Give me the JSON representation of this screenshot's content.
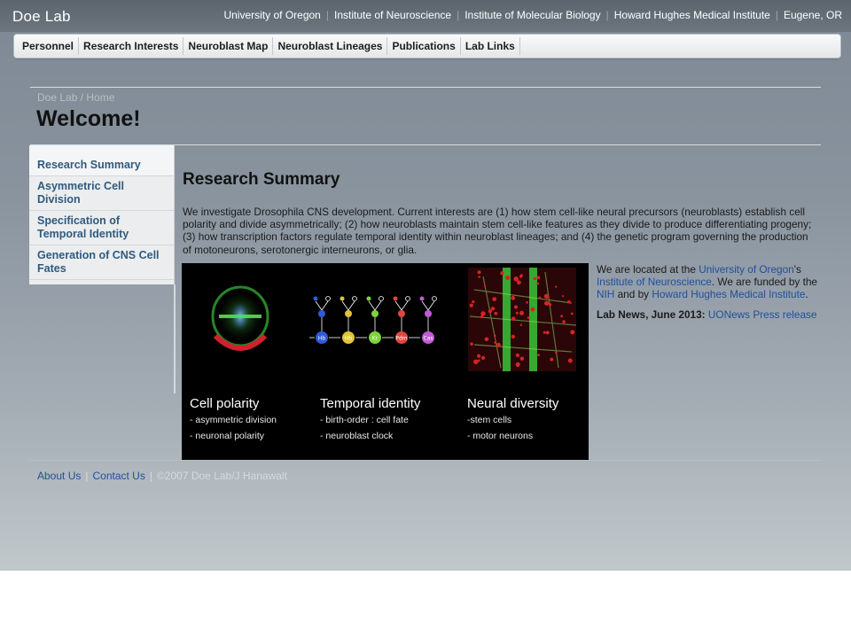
{
  "site": {
    "title": "Doe Lab"
  },
  "affiliations": [
    "University of Oregon",
    "Institute of Neuroscience",
    "Institute of Molecular Biology",
    "Howard Hughes Medical Institute",
    "Eugene, OR"
  ],
  "nav": [
    "Personnel",
    "Research Interests",
    "Neuroblast Map",
    "Neuroblast Lineages",
    "Publications",
    "Lab Links"
  ],
  "breadcrumb": {
    "root": "Doe Lab",
    "sep": " / ",
    "current": "Home"
  },
  "page_title": "Welcome!",
  "sidebar": [
    "Research Summary",
    "Asymmetric Cell Division",
    "Specification of Temporal Identity",
    "Generation of CNS Cell Fates"
  ],
  "main": {
    "title": "Research Summary",
    "summary": "We investigate Drosophila CNS development. Current interests are (1) how stem cell-like neural precursors (neuroblasts) establish cell polarity and divide asymmetrically; (2) how neuroblasts maintain stem cell-like features as they divide to produce differentiating progeny; (3) how transcription factors regulate temporal identity within neuroblast lineages; and (4) the genetic program governing the production of motoneurons, serotonergic interneurons, or glia."
  },
  "figure": {
    "panels": [
      {
        "heading": "Cell polarity",
        "lines": [
          "- asymmetric division",
          "- neuronal polarity"
        ]
      },
      {
        "heading": "Temporal identity",
        "lines": [
          "- birth-order : cell fate",
          "- neuroblast clock"
        ]
      },
      {
        "heading": "Neural diversity",
        "lines": [
          "-stem cells",
          "- motor neurons"
        ]
      }
    ],
    "factors": [
      "Hb",
      "Kr",
      "Pdm",
      "Cas"
    ],
    "factors_labels": [
      "Hb",
      "Hb",
      "Kr",
      "Pdm",
      "Cas"
    ]
  },
  "info": {
    "p1_a": "We are located at the ",
    "link_uo": "University of Oregon",
    "p1_b": "'s ",
    "link_ion": "Institute of Neuroscience",
    "p1_c": ". We are funded by the ",
    "link_nih": "NIH",
    "p1_d": " and by ",
    "link_hhmi": "Howard Hughes Medical Institute",
    "p1_e": ".",
    "news_label": "Lab News, June 2013:",
    "news_link": "UONews Press release"
  },
  "footer": {
    "about": "About Us",
    "contact": "Contact Us",
    "copyright": "©2007 Doe Lab/J Hanawalt"
  },
  "colors": {
    "link": "#1f4f9c",
    "sidebar_link": "#2f5a80",
    "series": [
      "#2f5bd8",
      "#e0c53a",
      "#7ed33a",
      "#e0473e",
      "#c25ad8"
    ]
  }
}
